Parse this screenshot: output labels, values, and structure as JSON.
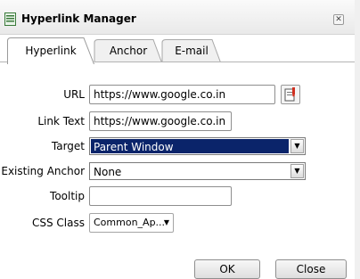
{
  "dialog": {
    "title": "Hyperlink Manager",
    "close_icon": "close-icon",
    "title_icon": "document-icon"
  },
  "tabs": [
    {
      "label": "Hyperlink",
      "active": true
    },
    {
      "label": "Anchor",
      "active": false
    },
    {
      "label": "E-mail",
      "active": false
    }
  ],
  "form": {
    "url": {
      "label": "URL",
      "value": "https://www.google.co.in"
    },
    "link_text": {
      "label": "Link Text",
      "value": "https://www.google.co.in"
    },
    "target": {
      "label": "Target",
      "value": "Parent Window"
    },
    "existing_anchor": {
      "label": "Existing Anchor",
      "value": "None"
    },
    "tooltip": {
      "label": "Tooltip",
      "value": ""
    },
    "css_class": {
      "label": "CSS Class",
      "value": "Common_Ap..."
    }
  },
  "buttons": {
    "ok": "OK",
    "close": "Close"
  },
  "colors": {
    "selection": "#0a246a",
    "title_gradient_top": "#fafafa"
  }
}
